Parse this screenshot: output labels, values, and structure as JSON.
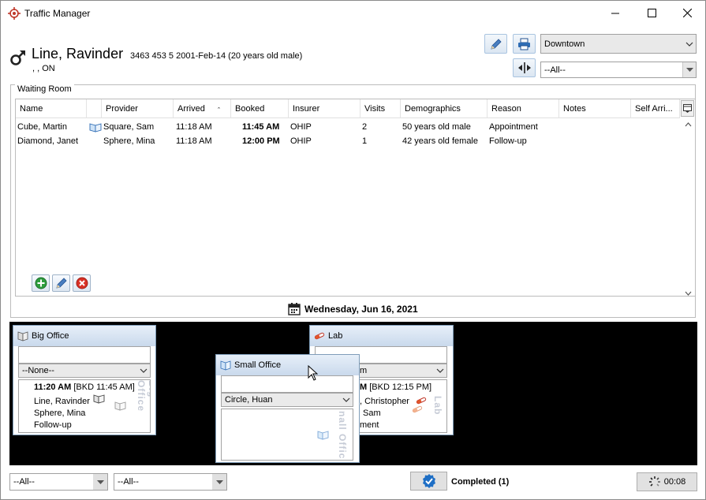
{
  "window": {
    "title": "Traffic Manager"
  },
  "patient": {
    "name": "Line, Ravinder",
    "info": "3463 453 5  2001-Feb-14 (20 years old male)",
    "address": ", , ON"
  },
  "header": {
    "location_select": "Downtown",
    "filter_select": "--All--"
  },
  "waiting_room": {
    "title": "Waiting Room",
    "columns": [
      "Name",
      "Provider",
      "Arrived",
      "Booked",
      "Insurer",
      "Visits",
      "Demographics",
      "Reason",
      "Notes",
      "Self Arri..."
    ],
    "sort_indicator": "ˆ",
    "rows": [
      {
        "name": "Cube, Martin",
        "provider": "Square, Sam",
        "arrived": "11:18 AM",
        "booked": "11:45 AM",
        "insurer": "OHIP",
        "visits": "2",
        "demographics": "50 years old male",
        "reason": "Appointment",
        "notes": "",
        "self": ""
      },
      {
        "name": "Diamond, Janet",
        "provider": "Sphere, Mina",
        "arrived": "11:18 AM",
        "booked": "12:00 PM",
        "insurer": "OHIP",
        "visits": "1",
        "demographics": "42 years old female",
        "reason": "Follow-up",
        "notes": "",
        "self": ""
      }
    ]
  },
  "date_bar": {
    "date": "Wednesday, Jun 16, 2021"
  },
  "rooms": {
    "big_office": {
      "title": "Big Office",
      "provider_select": "--None--",
      "vertical_label": "Big Office",
      "appointment": {
        "time": "11:20 AM",
        "booked": "[BKD 11:45 AM]",
        "patient": "Line, Ravinder",
        "provider": "Sphere, Mina",
        "reason": "Follow-up"
      }
    },
    "lab": {
      "title": "Lab",
      "provider_select": "m",
      "vertical_label": "Lab",
      "appointment": {
        "time": "M",
        "booked": "[BKD 12:15 PM]",
        "patient": ", Christopher",
        "provider": "Sam",
        "reason": "ment"
      }
    },
    "small_office": {
      "title": "Small Office",
      "provider_select": "Circle, Huan",
      "vertical_label": "nall Offic"
    }
  },
  "footer": {
    "filter1": "--All--",
    "filter2": "--All--",
    "completed_label": "Completed (1)",
    "timer": "00:08"
  }
}
